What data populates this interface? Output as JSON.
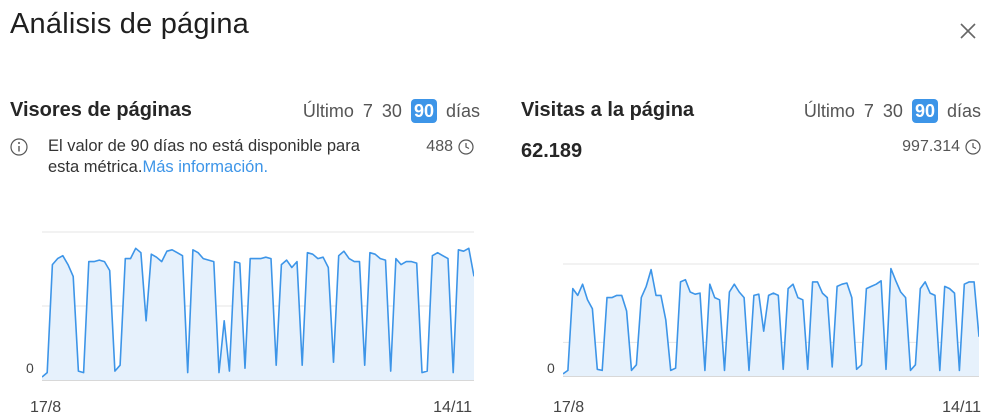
{
  "title": "Análisis de página",
  "close_icon": "close-icon",
  "accent_color": "#3d95e8",
  "left_panel": {
    "title": "Visores de páginas",
    "period_label": "Último",
    "period_7": "7",
    "period_30": "30",
    "period_90": "90",
    "period_unit": "días",
    "info_icon": "info-icon",
    "info_text": "El valor de 90 días no está disponible para esta métrica.",
    "info_link": "Más información.",
    "total_value": "488",
    "total_icon": "clock-icon"
  },
  "right_panel": {
    "title": "Visitas a la página",
    "period_label": "Último",
    "period_7": "7",
    "period_30": "30",
    "period_90": "90",
    "period_unit": "días",
    "value": "62.189",
    "total_value": "997.314",
    "total_icon": "clock-icon"
  },
  "chart_data": [
    {
      "type": "area",
      "x_start_label": "17/8",
      "x_end_label": "14/11",
      "y_zero_label": "0",
      "values": [
        0.02,
        0.05,
        0.78,
        0.82,
        0.84,
        0.78,
        0.7,
        0.06,
        0.05,
        0.8,
        0.8,
        0.81,
        0.8,
        0.74,
        0.06,
        0.1,
        0.82,
        0.82,
        0.89,
        0.86,
        0.4,
        0.85,
        0.83,
        0.8,
        0.87,
        0.88,
        0.86,
        0.84,
        0.05,
        0.88,
        0.86,
        0.82,
        0.81,
        0.8,
        0.05,
        0.4,
        0.06,
        0.8,
        0.79,
        0.08,
        0.82,
        0.82,
        0.82,
        0.83,
        0.82,
        0.1,
        0.78,
        0.81,
        0.76,
        0.8,
        0.1,
        0.86,
        0.85,
        0.82,
        0.83,
        0.76,
        0.12,
        0.84,
        0.87,
        0.82,
        0.8,
        0.8,
        0.1,
        0.86,
        0.85,
        0.82,
        0.81,
        0.06,
        0.82,
        0.78,
        0.8,
        0.8,
        0.79,
        0.05,
        0.06,
        0.84,
        0.86,
        0.84,
        0.82,
        0.05,
        0.88,
        0.87,
        0.89,
        0.7
      ]
    },
    {
      "type": "area",
      "x_start_label": "17/8",
      "x_end_label": "14/11",
      "y_zero_label": "0",
      "values": [
        0.02,
        0.05,
        0.78,
        0.72,
        0.82,
        0.68,
        0.6,
        0.06,
        0.05,
        0.7,
        0.7,
        0.72,
        0.72,
        0.58,
        0.05,
        0.1,
        0.7,
        0.8,
        0.95,
        0.72,
        0.72,
        0.5,
        0.05,
        0.07,
        0.84,
        0.86,
        0.75,
        0.73,
        0.74,
        0.05,
        0.82,
        0.7,
        0.68,
        0.05,
        0.75,
        0.82,
        0.75,
        0.7,
        0.05,
        0.72,
        0.73,
        0.4,
        0.72,
        0.74,
        0.72,
        0.06,
        0.78,
        0.82,
        0.7,
        0.68,
        0.06,
        0.84,
        0.84,
        0.74,
        0.7,
        0.08,
        0.8,
        0.82,
        0.83,
        0.7,
        0.06,
        0.1,
        0.78,
        0.8,
        0.82,
        0.85,
        0.06,
        0.96,
        0.85,
        0.75,
        0.7,
        0.05,
        0.1,
        0.78,
        0.84,
        0.74,
        0.72,
        0.05,
        0.8,
        0.78,
        0.74,
        0.05,
        0.82,
        0.84,
        0.84,
        0.35
      ]
    }
  ]
}
